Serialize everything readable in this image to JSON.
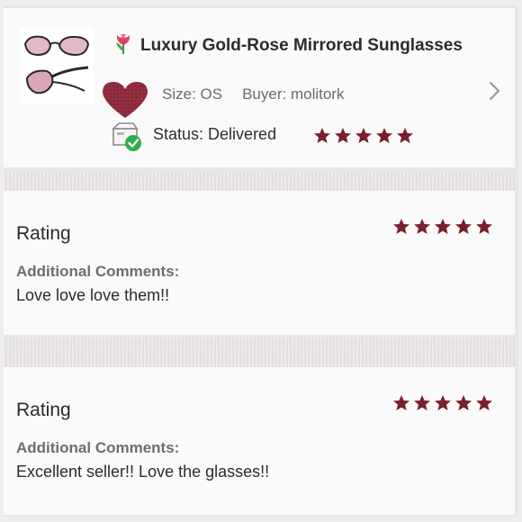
{
  "product": {
    "title": "Luxury Gold-Rose Mirrored Sunglasses",
    "size_label": "Size: OS",
    "buyer_label": "Buyer: molitork",
    "status_label": "Status:",
    "status_value": "Delivered",
    "star_rating": 5,
    "icons": [
      "tulip-emoji-icon",
      "heart-icon",
      "chevron-right-icon",
      "delivered-box-icon"
    ]
  },
  "reviews": [
    {
      "rating_label": "Rating",
      "stars": 5,
      "comments_label": "Additional Comments:",
      "comment": "Love love love them!!"
    },
    {
      "rating_label": "Rating",
      "stars": 5,
      "comments_label": "Additional Comments:",
      "comment": "Excellent seller!! Love the glasses!!"
    }
  ],
  "colors": {
    "star": "#7a1f2e",
    "heart": "#8a2a3b",
    "check": "#2fae4e",
    "background": "#fbfafa"
  }
}
